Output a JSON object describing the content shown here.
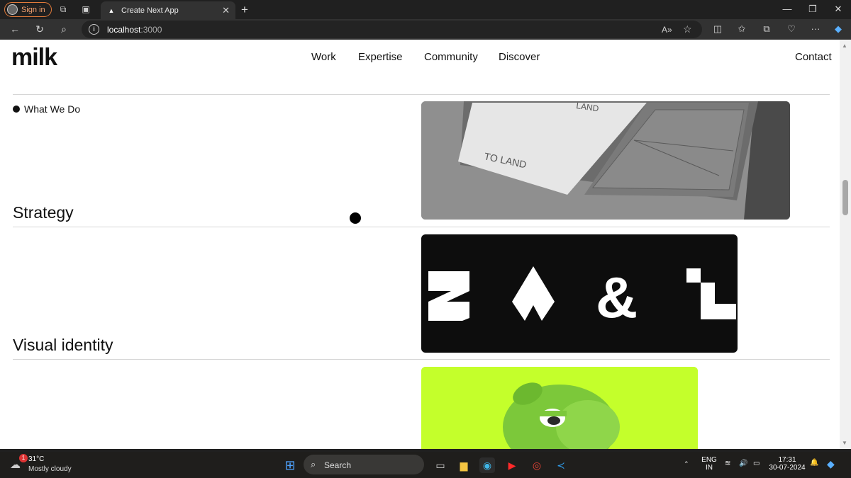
{
  "browser": {
    "signin_label": "Sign in",
    "tab_title": "Create Next App",
    "url_host": "localhost",
    "url_port": ":3000"
  },
  "site": {
    "logo": "milk",
    "nav": [
      "Work",
      "Expertise",
      "Community",
      "Discover"
    ],
    "contact": "Contact"
  },
  "content": {
    "eyebrow": "What We Do",
    "sections": [
      {
        "title": "Strategy",
        "image_caption_top": "LAND",
        "image_caption": "TO LAND"
      },
      {
        "title": "Visual identity",
        "glyphs": [
          "S",
          "A",
          "&",
          "L"
        ]
      },
      {
        "title": ""
      }
    ]
  },
  "taskbar": {
    "weather_temp": "31°C",
    "weather_desc": "Mostly cloudy",
    "weather_badge": "1",
    "search_label": "Search",
    "lang": "ENG",
    "region": "IN",
    "time": "17:31",
    "date": "30-07-2024"
  },
  "colors": {
    "accent_green": "#c4ff2b",
    "dark_card": "#0d0d0d",
    "text": "#111111"
  }
}
